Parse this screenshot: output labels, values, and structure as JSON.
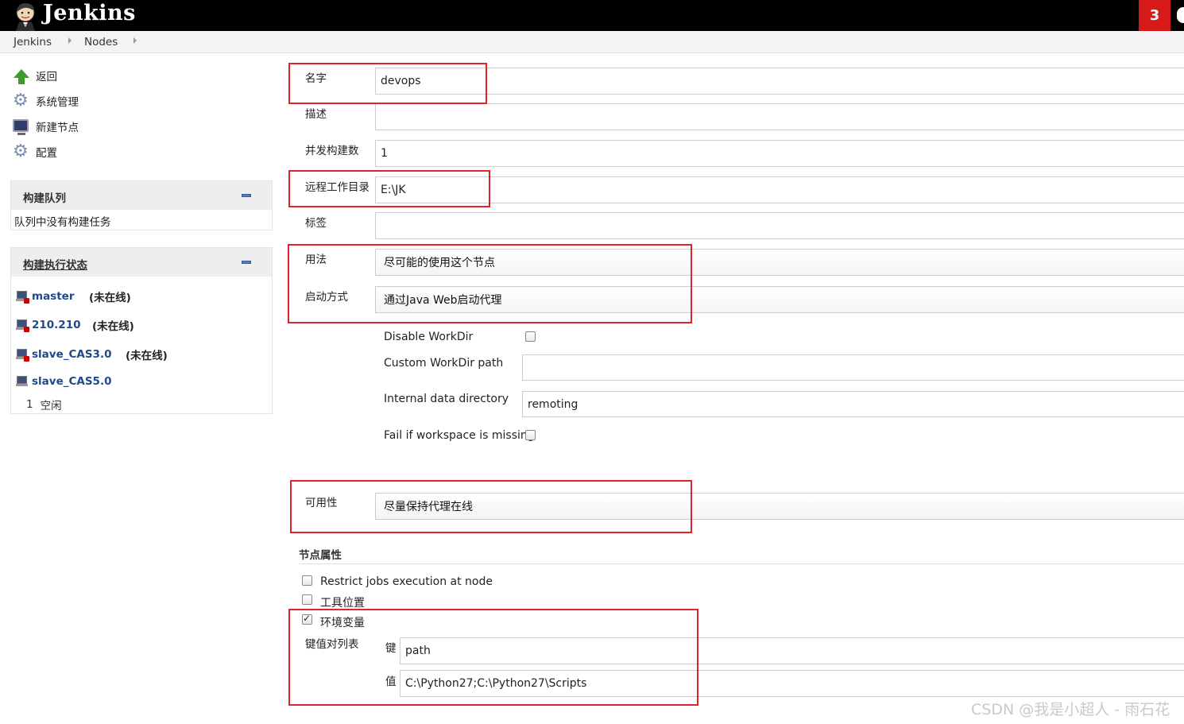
{
  "header": {
    "app_title": "Jenkins",
    "notification_count": "3"
  },
  "breadcrumb": [
    "Jenkins",
    "Nodes"
  ],
  "side_tasks": [
    {
      "label": "返回",
      "icon": "up-arrow-icon"
    },
    {
      "label": "系统管理",
      "icon": "gear-icon"
    },
    {
      "label": "新建节点",
      "icon": "computer-icon"
    },
    {
      "label": "配置",
      "icon": "gear-icon"
    }
  ],
  "build_queue": {
    "title": "构建队列",
    "empty_text": "队列中没有构建任务"
  },
  "executors": {
    "title": "构建执行状态",
    "nodes": [
      {
        "name": "master",
        "status": "(未在线)"
      },
      {
        "name": "210.210",
        "status": "(未在线)"
      },
      {
        "name": "slave_CAS3.0",
        "status": "(未在线)"
      },
      {
        "name": "slave_CAS5.0",
        "status": ""
      }
    ],
    "idle_number": "1",
    "idle_text": "空闲"
  },
  "form": {
    "name_label": "名字",
    "name_value": "devops",
    "desc_label": "描述",
    "desc_value": "",
    "executors_label": "并发构建数",
    "executors_value": "1",
    "remote_dir_label": "远程工作目录",
    "remote_dir_value": "E:\\JK",
    "labels_label": "标签",
    "labels_value": "",
    "usage_label": "用法",
    "usage_value": "尽可能的使用这个节点",
    "launch_label": "启动方式",
    "launch_value": "通过Java Web启动代理",
    "disable_workdir_label": "Disable WorkDir",
    "custom_workdir_label": "Custom WorkDir path",
    "custom_workdir_value": "",
    "internal_dir_label": "Internal data directory",
    "internal_dir_value": "remoting",
    "fail_missing_label": "Fail if workspace is missing",
    "availability_label": "可用性",
    "availability_value": "尽量保持代理在线",
    "node_props_title": "节点属性",
    "restrict_label": "Restrict jobs execution at node",
    "tool_location_label": "工具位置",
    "env_vars_label": "环境变量",
    "kv_list_label": "键值对列表",
    "key_label": "键",
    "key_value": "path",
    "value_label": "值",
    "value_value": "C:\\Python27;C:\\Python27\\Scripts"
  },
  "watermark": "CSDN @我是小超人 - 雨石花"
}
